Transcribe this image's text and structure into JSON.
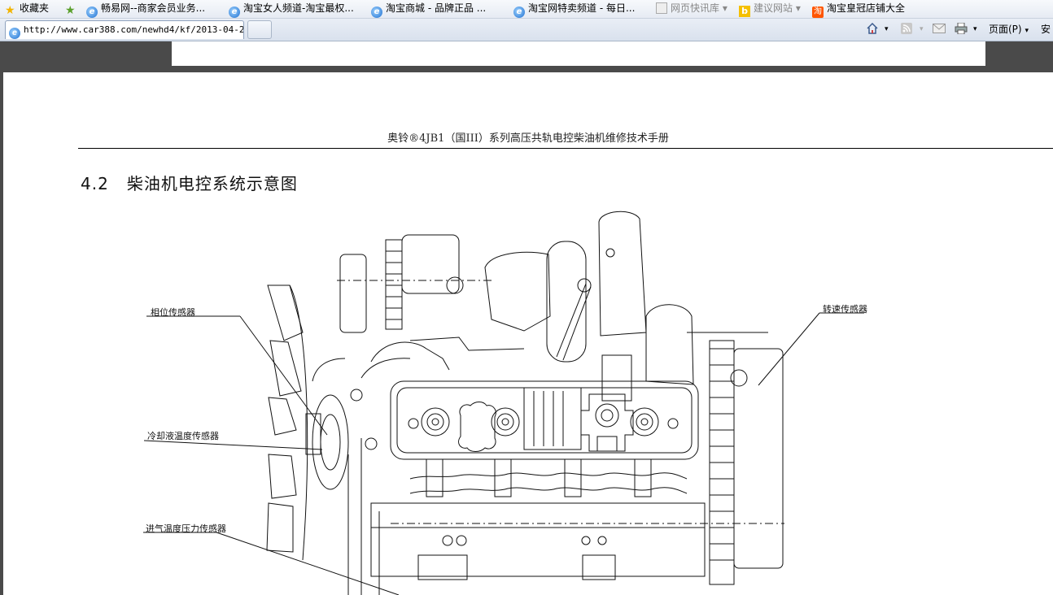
{
  "favorites_bar": {
    "favorites_label": "收藏夹",
    "links": [
      "畅易网--商家会员业务...",
      "淘宝女人频道-淘宝最权...",
      "淘宝商城 - 品牌正品 ...",
      "淘宝网特卖频道 - 每日...",
      "网页快讯库",
      "建议网站",
      "淘宝皇冠店铺大全"
    ]
  },
  "tab": {
    "url": "http://www.car388.com/newhd4/kf/2013-04-2..."
  },
  "command_bar": {
    "page_menu": "页面(P)",
    "safety_menu": "安"
  },
  "document": {
    "running_head": "奥铃®4JB1（国III）系列高压共轨电控柴油机维修技术手册",
    "section_number": "4.2",
    "section_title": "柴油机电控系统示意图",
    "callouts": {
      "cam_sensor": "相位传感器",
      "coolant_sensor": "冷却液温度传感器",
      "intake_sensor": "进气温度压力传感器",
      "speed_sensor": "转速传感器"
    }
  },
  "colors": {
    "ie_blue": "#1d6fd0",
    "star_gold": "#f2b400",
    "taobao_orange": "#ff5500",
    "bing_yellow": "#f5c000"
  }
}
